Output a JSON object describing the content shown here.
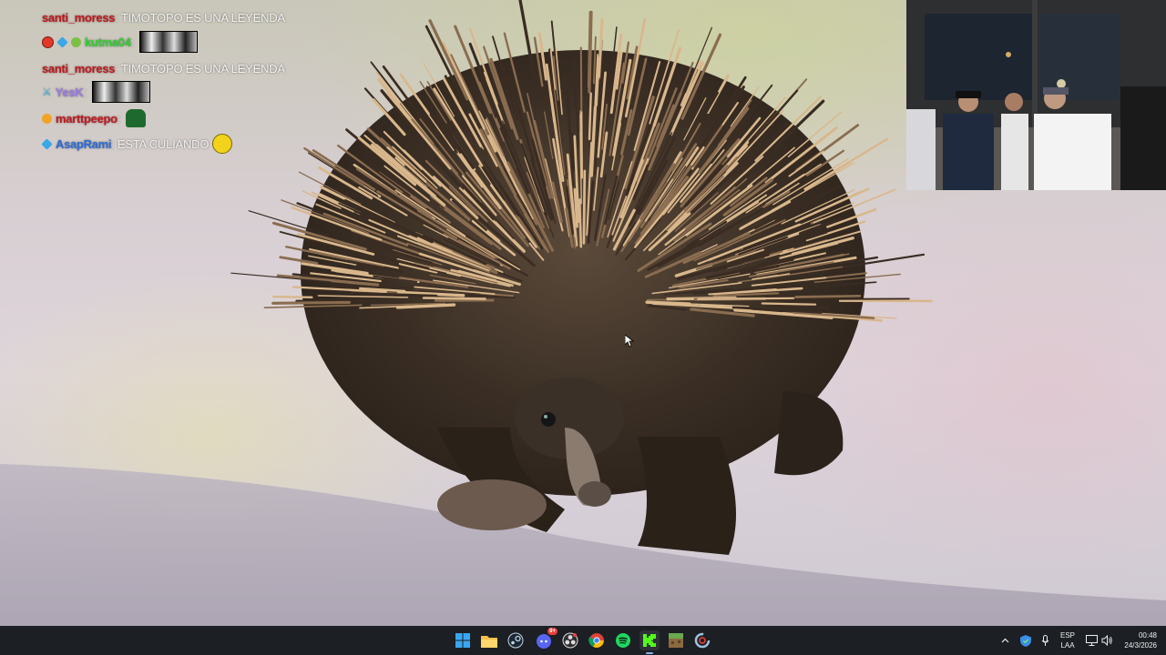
{
  "chat": {
    "lines": [
      {
        "user": "santi_moress",
        "user_color": "#c4161c",
        "message": "TIMOTOPO ES UNA LEYENDA"
      },
      {
        "user": "kutma04",
        "user_color": "#2fd12f",
        "badges": [
          "red-circle-badge",
          "blue-cube-badge",
          "frog-badge"
        ]
      },
      {
        "user": "santi_moress",
        "user_color": "#c4161c",
        "message": "TIMOTOPO ES UNA LEYENDA"
      },
      {
        "user": "YesK",
        "user_color": "#9b7be8",
        "badges": [
          "sword-badge"
        ]
      },
      {
        "user": "marttpeepo",
        "user_color": "#c4161c",
        "badges": [
          "orange-circle-badge"
        ]
      },
      {
        "user": "AsapRami",
        "user_color": "#2a6bd9",
        "message": "ESTA CULIANDO",
        "badges": [
          "blue-cube-badge"
        ]
      }
    ]
  },
  "taskbar": {
    "apps": [
      "windows-start-icon",
      "file-explorer-icon",
      "steam-icon",
      "discord-icon",
      "obs-icon",
      "chrome-icon",
      "spotify-icon",
      "kick-icon",
      "minecraft-icon",
      "ccleaner-icon"
    ],
    "discord_badge": "9+",
    "tray": {
      "lang_line1": "ESP",
      "lang_line2": "LAA",
      "time": "00:48",
      "date": "24/3/2026"
    }
  },
  "colors": {
    "taskbar_bg": "#1c1f24",
    "kick_green": "#53fc18"
  }
}
